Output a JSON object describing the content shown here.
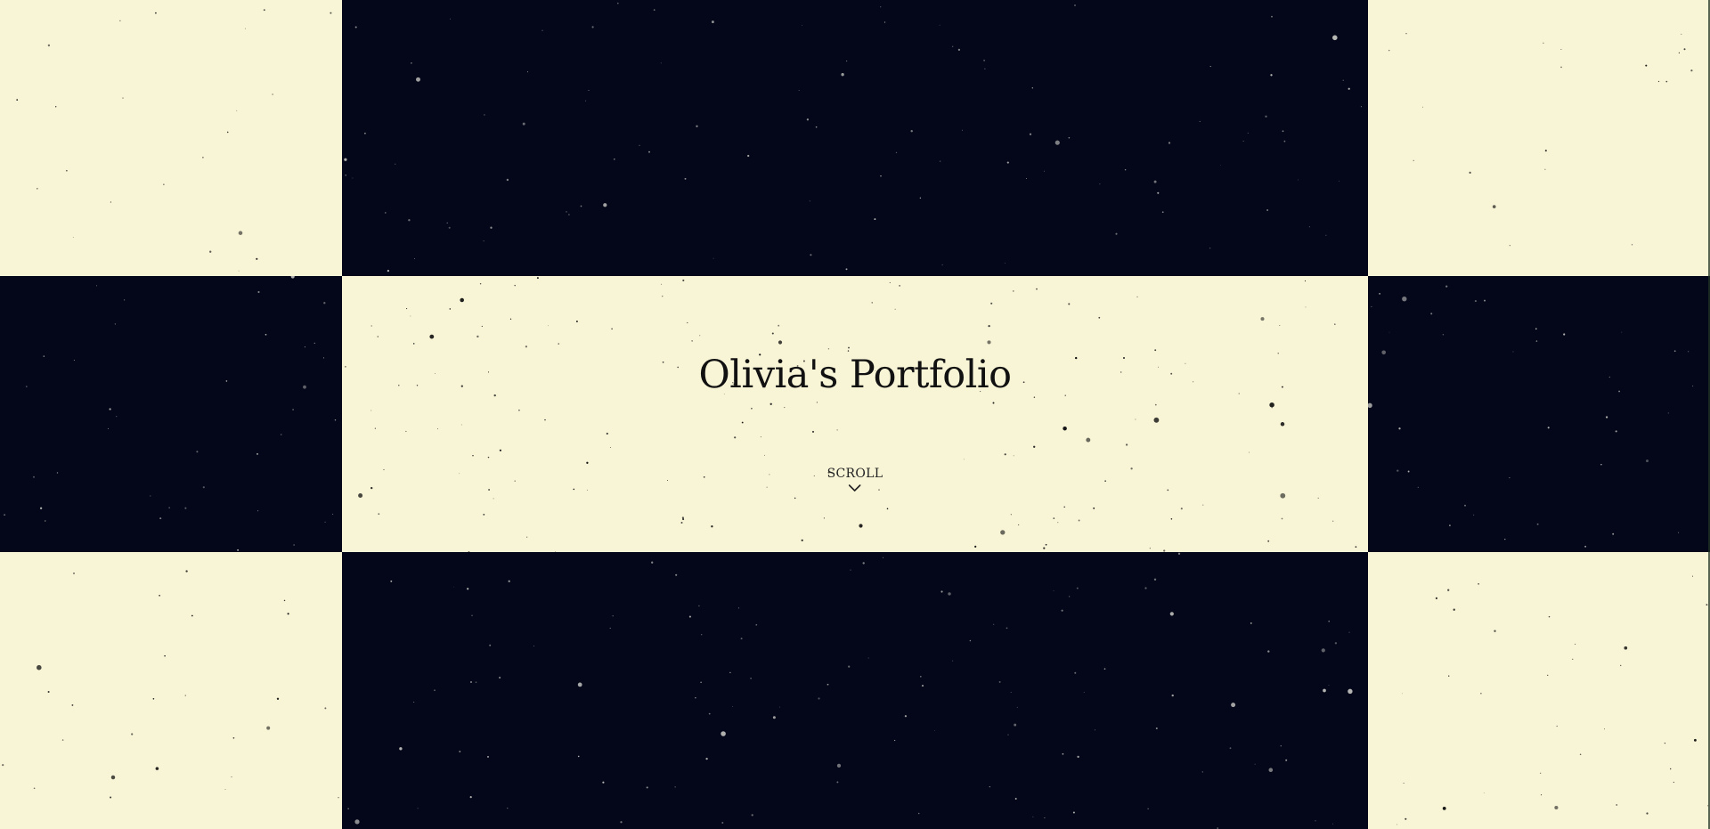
{
  "hero": {
    "title": "Olivia's Portfolio",
    "scroll_label": "SCROLL",
    "scroll_icon": "chevron-down-icon"
  },
  "colors": {
    "cream": "#f8f4d6",
    "navy": "#04071a",
    "ink": "#111111",
    "star_on_dark": "#d7d7d0"
  }
}
